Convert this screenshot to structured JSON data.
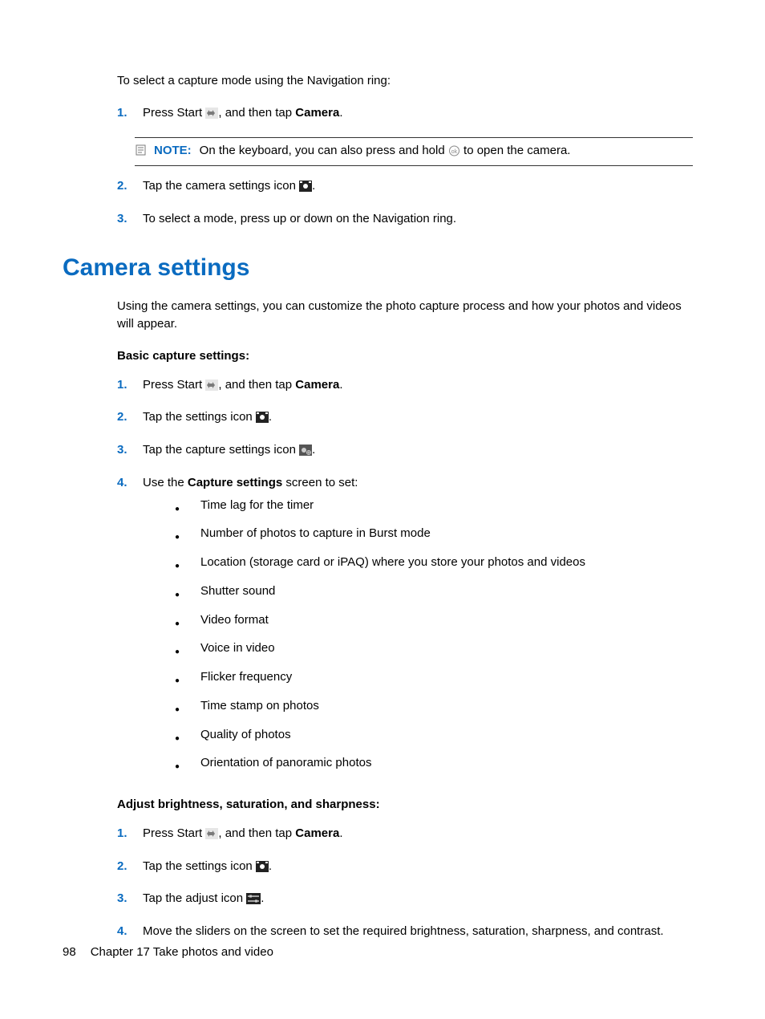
{
  "top": {
    "intro": "To select a capture mode using the Navigation ring:",
    "steps": [
      {
        "n": "1.",
        "pre": "Press Start ",
        "post": ", and then tap ",
        "bold": "Camera",
        "end": "."
      },
      {
        "n": "2.",
        "pre": "Tap the camera settings icon ",
        "post": "."
      },
      {
        "n": "3.",
        "pre": "To select a mode, press up or down on the Navigation ring."
      }
    ],
    "note": {
      "label": "NOTE:",
      "pre": "On the keyboard, you can also press and hold ",
      "post": " to open the camera."
    }
  },
  "h1": "Camera settings",
  "sec_intro": "Using the camera settings, you can customize the photo capture process and how your photos and videos will appear.",
  "basic": {
    "heading": "Basic capture settings",
    "colon": ":",
    "steps": [
      {
        "n": "1.",
        "pre": "Press Start ",
        "post": ", and then tap ",
        "bold": "Camera",
        "end": "."
      },
      {
        "n": "2.",
        "pre": "Tap the settings icon ",
        "post": "."
      },
      {
        "n": "3.",
        "pre": "Tap the capture settings icon ",
        "post": "."
      },
      {
        "n": "4.",
        "pre": "Use the ",
        "bold": "Capture settings",
        "post": " screen to set:"
      }
    ],
    "bullets": [
      "Time lag for the timer",
      "Number of photos to capture in Burst mode",
      "Location (storage card or iPAQ) where you store your photos and videos",
      "Shutter sound",
      "Video format",
      "Voice in video",
      "Flicker frequency",
      "Time stamp on photos",
      "Quality of photos",
      "Orientation of panoramic photos"
    ]
  },
  "adjust": {
    "heading": "Adjust brightness, saturation, and sharpness",
    "colon": ":",
    "steps": [
      {
        "n": "1.",
        "pre": "Press Start ",
        "post": ", and then tap ",
        "bold": "Camera",
        "end": "."
      },
      {
        "n": "2.",
        "pre": "Tap the settings icon ",
        "post": "."
      },
      {
        "n": "3.",
        "pre": "Tap the adjust icon ",
        "post": "."
      },
      {
        "n": "4.",
        "pre": "Move the sliders on the screen to set the required brightness, saturation, sharpness, and contrast."
      }
    ]
  },
  "footer": {
    "page": "98",
    "chapter": "Chapter 17   Take photos and video"
  }
}
